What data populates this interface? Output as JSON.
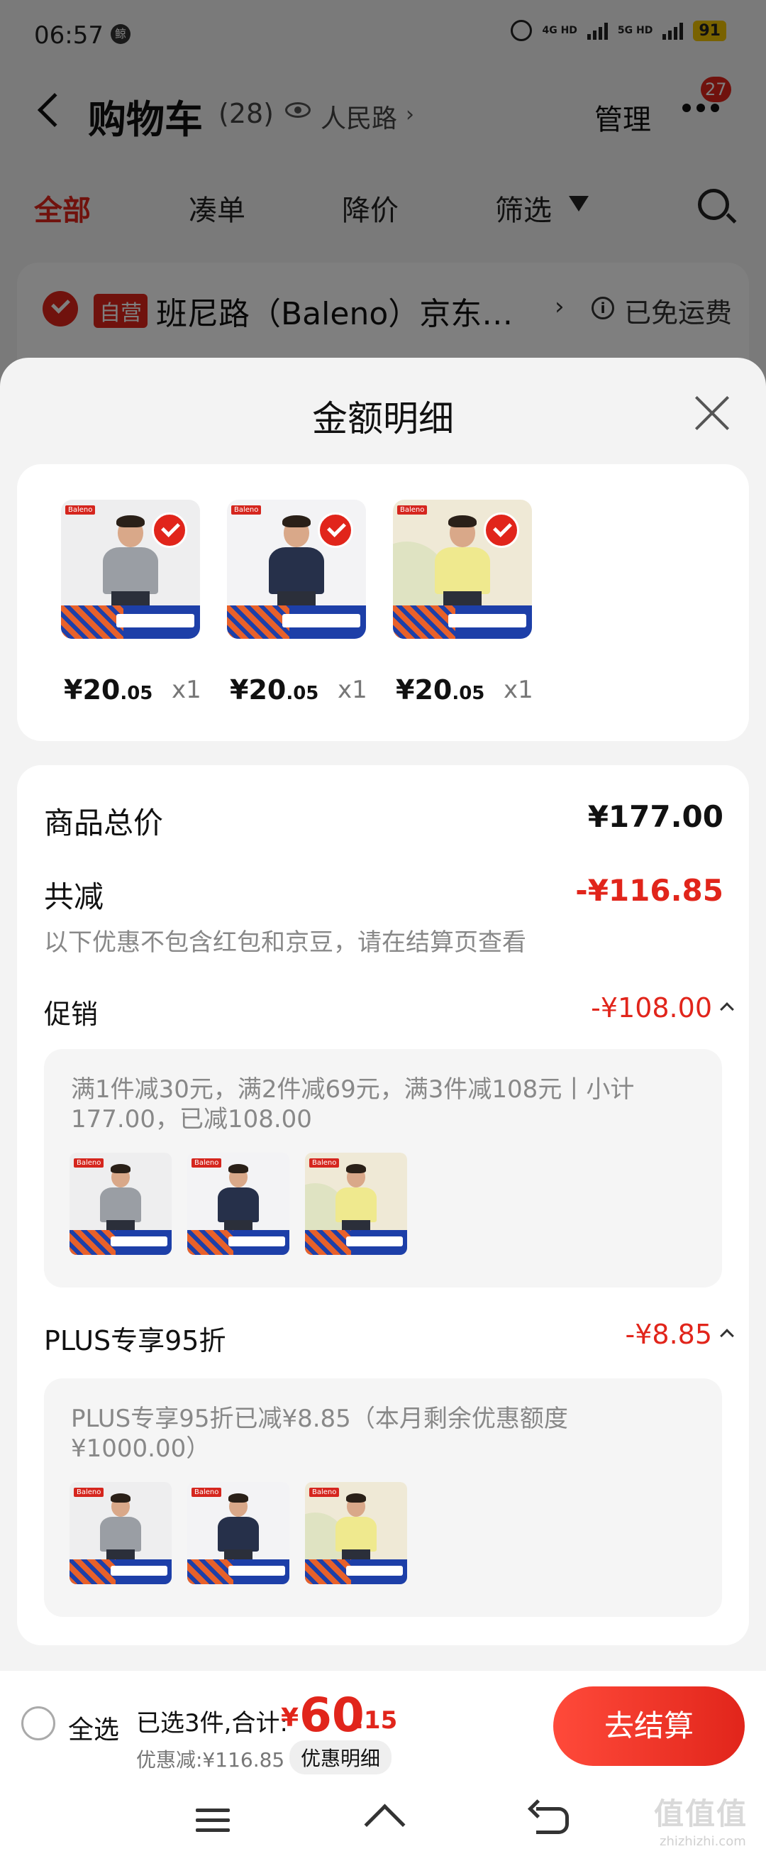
{
  "status_bar": {
    "time": "06:57",
    "badge": "鲸",
    "net1": "4G HD",
    "net2": "5G HD",
    "battery": "91"
  },
  "nav": {
    "title": "购物车",
    "count": "(28)",
    "location": "人民路",
    "loc_arrow": "›",
    "manage": "管理",
    "more_badge": "27"
  },
  "filters": [
    "全部",
    "凑单",
    "降价",
    "筛选"
  ],
  "store": {
    "tag": "自营",
    "name": "班尼路（Baleno）京东…",
    "arrow": "›",
    "info": "i",
    "shipping": "已免运费"
  },
  "sheet": {
    "title": "金额明细",
    "products": [
      {
        "price_int": "¥20",
        "price_dec": ".05",
        "qty": "x1",
        "color": "#9a9ea4",
        "bg": "#eeeeef"
      },
      {
        "price_int": "¥20",
        "price_dec": ".05",
        "qty": "x1",
        "color": "#26304a",
        "bg": "#f3f3f5"
      },
      {
        "price_int": "¥20",
        "price_dec": ".05",
        "qty": "x1",
        "color": "#efe98e",
        "bg": "#efe9d6"
      }
    ],
    "brand_tag": "Baleno",
    "total_label": "商品总价",
    "total_value": "¥177.00",
    "reduce_label": "共减",
    "reduce_value": "-¥116.85",
    "reduce_note": "以下优惠不包含红包和京豆，请在结算页查看",
    "promo_label": "促销",
    "promo_value": "-¥108.00",
    "promo_desc": "满1件减30元，满2件减69元，满3件减108元丨小计177.00，已减108.00",
    "plus_label": "PLUS专享95折",
    "plus_value": "-¥8.85",
    "plus_desc": "PLUS专享95折已减¥8.85（本月剩余优惠额度¥1000.00）"
  },
  "bottom": {
    "select_all": "全选",
    "selected_text": "已选3件,合计:",
    "currency": "¥",
    "total_int": "60",
    "total_dec": ".15",
    "discount_text": "优惠减:¥116.85",
    "discount_detail": "优惠明细",
    "checkout": "去结算"
  },
  "watermark": {
    "text": "值值值",
    "url": "zhizhizhi.com"
  },
  "colors": {
    "accent": "#e1251b",
    "sheet_bg": "#f3f3f3"
  }
}
